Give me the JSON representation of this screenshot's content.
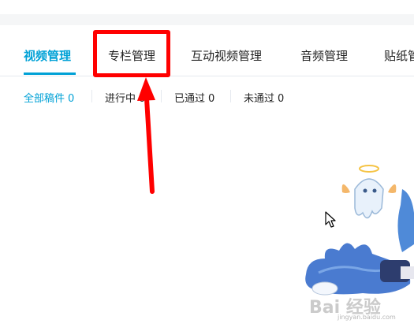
{
  "tabs": [
    {
      "label": "视频管理",
      "active": true
    },
    {
      "label": "专栏管理",
      "active": false
    },
    {
      "label": "互动视频管理",
      "active": false
    },
    {
      "label": "音频管理",
      "active": false
    },
    {
      "label": "贴纸管",
      "active": false
    }
  ],
  "filters": [
    {
      "label": "全部稿件",
      "count": "0",
      "active": true
    },
    {
      "label": "进行中",
      "count": "0",
      "active": false
    },
    {
      "label": "已通过",
      "count": "0",
      "active": false
    },
    {
      "label": "未通过",
      "count": "0",
      "active": false
    }
  ],
  "annotation": {
    "highlighted_tab": "专栏管理",
    "color": "#ff0000"
  },
  "watermark": {
    "brand": "Bai 经验",
    "url": "jingyan.baidu.com"
  },
  "colors": {
    "accent": "#00a1d6",
    "text": "#212121",
    "divider": "#e5e9ef"
  },
  "icons": {
    "cursor": "mouse-pointer-icon",
    "mascot": "anime-mascot-illustration"
  }
}
